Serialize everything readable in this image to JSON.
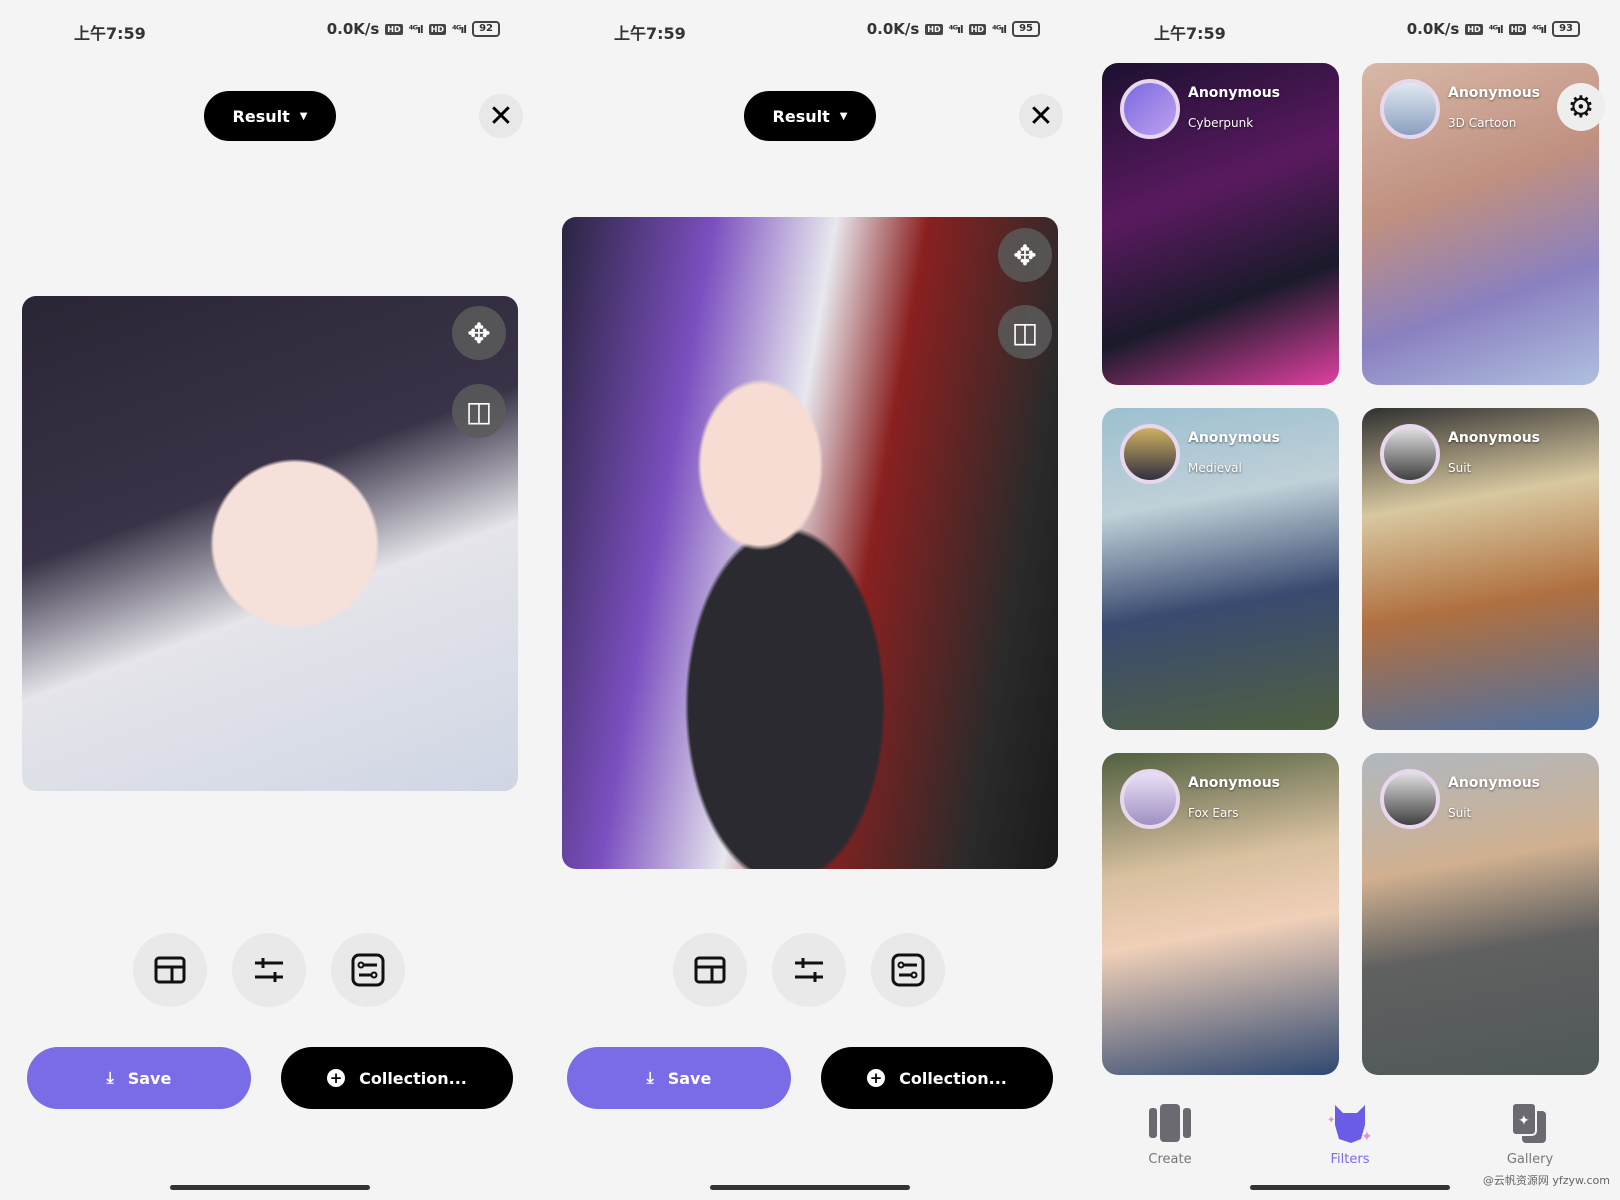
{
  "panels": [
    {
      "status": {
        "time": "上午7:59",
        "speed": "0.0K/s",
        "battery": "92"
      },
      "result_label": "Result",
      "save_label": "Save",
      "collection_label": "Collection..."
    },
    {
      "status": {
        "time": "上午7:59",
        "speed": "0.0K/s",
        "battery": "95"
      },
      "result_label": "Result",
      "save_label": "Save",
      "collection_label": "Collection..."
    },
    {
      "status": {
        "time": "上午7:59",
        "speed": "0.0K/s",
        "battery": "93"
      }
    }
  ],
  "cards": [
    {
      "name": "Anonymous",
      "style": "Cyberpunk"
    },
    {
      "name": "Anonymous",
      "style": "3D Cartoon"
    },
    {
      "name": "Anonymous",
      "style": "Medieval"
    },
    {
      "name": "Anonymous",
      "style": "Suit"
    },
    {
      "name": "Anonymous",
      "style": "Fox Ears"
    },
    {
      "name": "Anonymous",
      "style": "Suit"
    }
  ],
  "nav": [
    {
      "label": "Create",
      "icon": "cards-icon"
    },
    {
      "label": "Filters",
      "icon": "fox-icon",
      "active": true
    },
    {
      "label": "Gallery",
      "icon": "gallery-icon"
    }
  ],
  "watermark": "@云帆资源网 yfzyw.com",
  "colors": {
    "accent": "#7a6ce6",
    "dark": "#000000"
  }
}
